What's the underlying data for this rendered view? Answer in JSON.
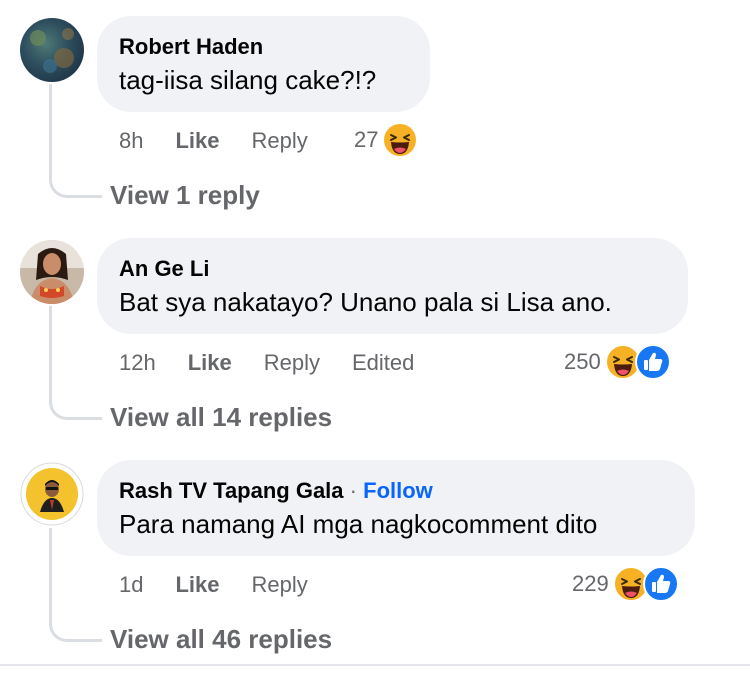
{
  "comments": [
    {
      "author": "Robert Haden",
      "text": "tag-iisa silang cake?!?",
      "time": "8h",
      "like_label": "Like",
      "reply_label": "Reply",
      "reaction_count": "27",
      "reactions": [
        "haha"
      ],
      "view_replies": "View 1 reply"
    },
    {
      "author": "An Ge Li",
      "text": "Bat sya nakatayo? Unano pala si Lisa ano.",
      "time": "12h",
      "like_label": "Like",
      "reply_label": "Reply",
      "edited_label": "Edited",
      "reaction_count": "250",
      "reactions": [
        "haha",
        "like"
      ],
      "view_replies": "View all 14 replies"
    },
    {
      "author": "Rash TV Tapang Gala",
      "separator": "·",
      "follow_label": "Follow",
      "text": "Para namang AI mga nagkocomment dito",
      "time": "1d",
      "like_label": "Like",
      "reply_label": "Reply",
      "reaction_count": "229",
      "reactions": [
        "haha",
        "like"
      ],
      "view_replies": "View all 46 replies"
    }
  ],
  "colors": {
    "bubble": "#f0f2f5",
    "meta_text": "#65676b",
    "follow": "#0866ff",
    "like_blue": "#1877f2",
    "haha_yellow": "#f7b125"
  }
}
